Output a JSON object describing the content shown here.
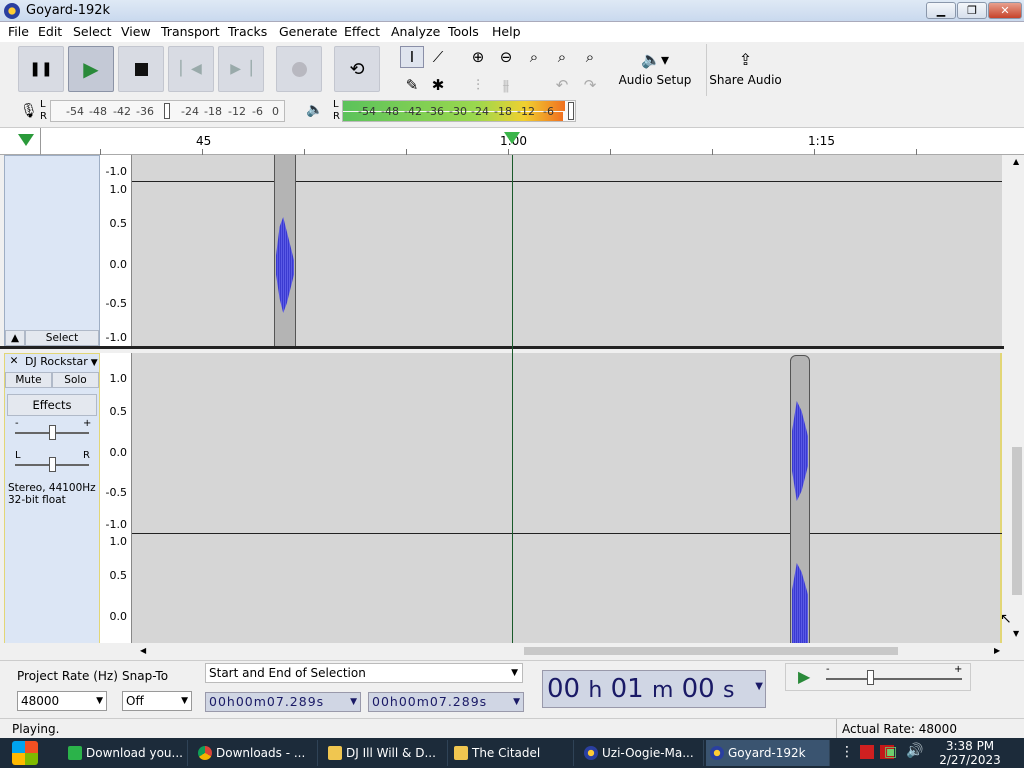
{
  "window": {
    "title": "Goyard-192k"
  },
  "menu": [
    "File",
    "Edit",
    "Select",
    "View",
    "Transport",
    "Tracks",
    "Generate",
    "Effect",
    "Analyze",
    "Tools",
    "Help"
  ],
  "toolbar": {
    "audio_setup": "Audio Setup",
    "share_audio": "Share Audio"
  },
  "meters": {
    "record_ticks": [
      "-54",
      "-48",
      "-42",
      "-36",
      "-24",
      "-18",
      "-12",
      "-6",
      "0"
    ],
    "play_ticks": [
      "-54",
      "-48",
      "-42",
      "-36",
      "-30",
      "-24",
      "-18",
      "-12",
      "-6"
    ],
    "lr": [
      "L",
      "R"
    ]
  },
  "ruler": {
    "ticks": [
      "45",
      "1:00",
      "1:15"
    ]
  },
  "track1": {
    "select_label": "Select",
    "scale": [
      "-1.0",
      "1.0",
      "0.5",
      "0.0",
      "-0.5",
      "-1.0"
    ]
  },
  "track2": {
    "name": "DJ Rockstar",
    "mute": "Mute",
    "solo": "Solo",
    "effects": "Effects",
    "gain_minus": "-",
    "gain_plus": "+",
    "pan_l": "L",
    "pan_r": "R",
    "info": "Stereo, 44100Hz",
    "info2": "32-bit float",
    "scale": [
      "1.0",
      "0.5",
      "0.0",
      "-0.5",
      "-1.0",
      "1.0",
      "0.5",
      "0.0"
    ]
  },
  "bottom": {
    "project_rate_label": "Project Rate (Hz)",
    "snap_label": "Snap-To",
    "project_rate": "48000",
    "snap": "Off",
    "selection_mode": "Start and End of Selection",
    "sel_start": "00h00m07.289s",
    "sel_end": "00h00m07.289s",
    "time_h": "00",
    "time_m": "01",
    "time_s": "00",
    "h": "h",
    "m": "m",
    "s": "s",
    "speed_minus": "-",
    "speed_plus": "+"
  },
  "status": {
    "text": "Playing.",
    "rate": "Actual Rate: 48000"
  },
  "taskbar": {
    "items": [
      "Download you...",
      "Downloads - ...",
      "DJ Ill Will & D...",
      "The Citadel",
      "Uzi-Oogie-Ma...",
      "Goyard-192k"
    ],
    "time": "3:38 PM",
    "date": "2/27/2023"
  }
}
